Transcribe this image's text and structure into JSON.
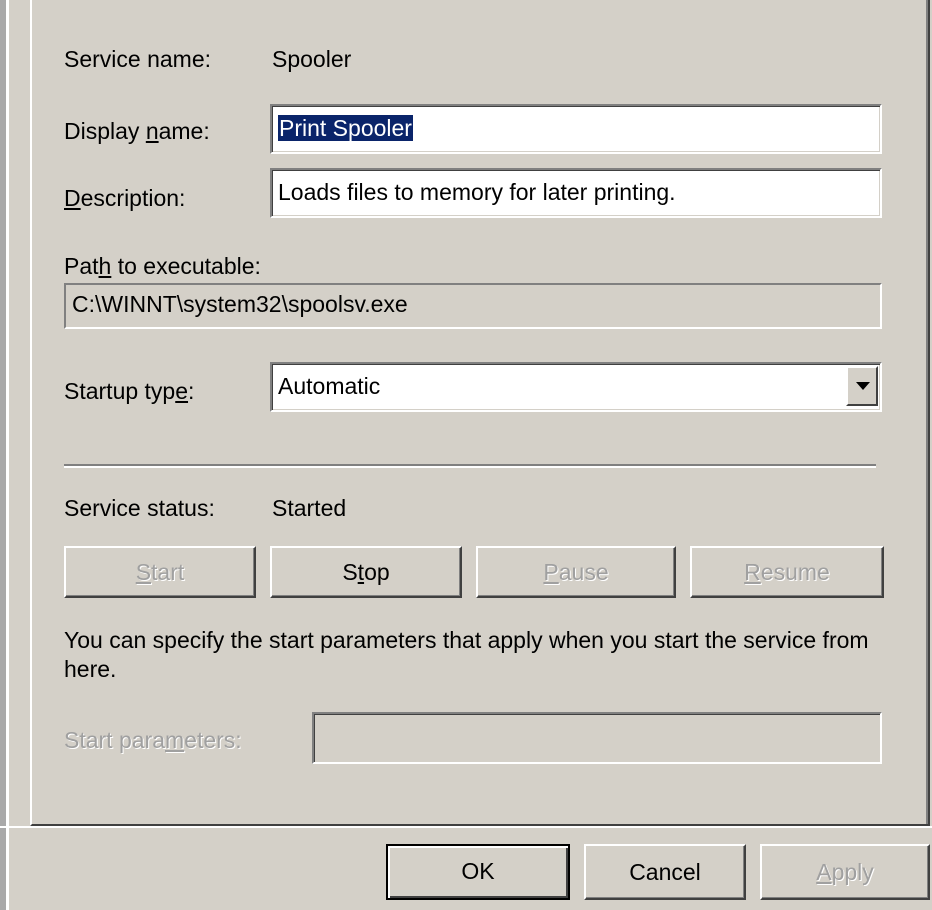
{
  "general": {
    "service_name_label": "Service name:",
    "service_name_value": "Spooler",
    "display_name_label_pre": "Display ",
    "display_name_label_ul": "n",
    "display_name_label_post": "ame:",
    "display_name_value": "Print Spooler",
    "description_label_ul": "D",
    "description_label_post": "escription:",
    "description_value": "Loads files to memory for later printing.",
    "path_label_pre": "Pat",
    "path_label_ul": "h",
    "path_label_post": " to executable:",
    "path_value": "C:\\WINNT\\system32\\spoolsv.exe",
    "startup_type_label_pre": "Startup typ",
    "startup_type_label_ul": "e",
    "startup_type_label_post": ":",
    "startup_type_value": "Automatic",
    "service_status_label": "Service status:",
    "service_status_value": "Started"
  },
  "control_buttons": {
    "start_ul": "S",
    "start_post": "tart",
    "stop_pre": "S",
    "stop_ul": "t",
    "stop_post": "op",
    "pause_ul": "P",
    "pause_post": "ause",
    "resume_ul": "R",
    "resume_post": "esume"
  },
  "parameters": {
    "info_text": "You can specify the start parameters that apply when you start the service from here.",
    "start_params_label_pre": "Start para",
    "start_params_label_ul": "m",
    "start_params_label_post": "eters:",
    "start_params_value": ""
  },
  "dialog_buttons": {
    "ok": "OK",
    "cancel": "Cancel",
    "apply_ul": "A",
    "apply_post": "pply"
  },
  "colors": {
    "face": "#d4d0c8",
    "selection": "#0a246a",
    "disabled_text": "#a0a0a0"
  }
}
